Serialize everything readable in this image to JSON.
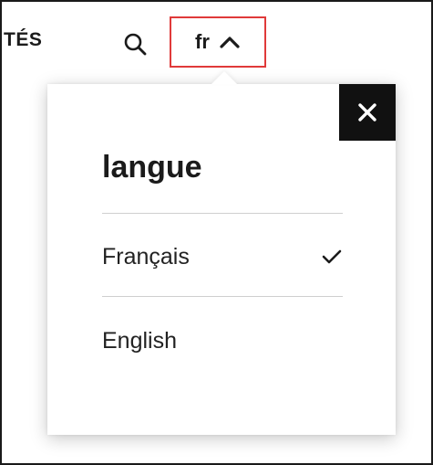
{
  "header": {
    "nav_partial_text": "TÉS",
    "search_icon": "search-icon",
    "lang_toggle": {
      "code": "fr",
      "chevron_icon": "chevron-up-icon",
      "highlight_color": "#e03a3a"
    }
  },
  "language_panel": {
    "title": "langue",
    "close_icon": "close-icon",
    "options": [
      {
        "label": "Français",
        "selected": true,
        "icon": "check-icon"
      },
      {
        "label": "English",
        "selected": false
      }
    ]
  },
  "colors": {
    "text": "#1b1b1b",
    "close_bg": "#111111",
    "divider": "#cfcfcf"
  }
}
